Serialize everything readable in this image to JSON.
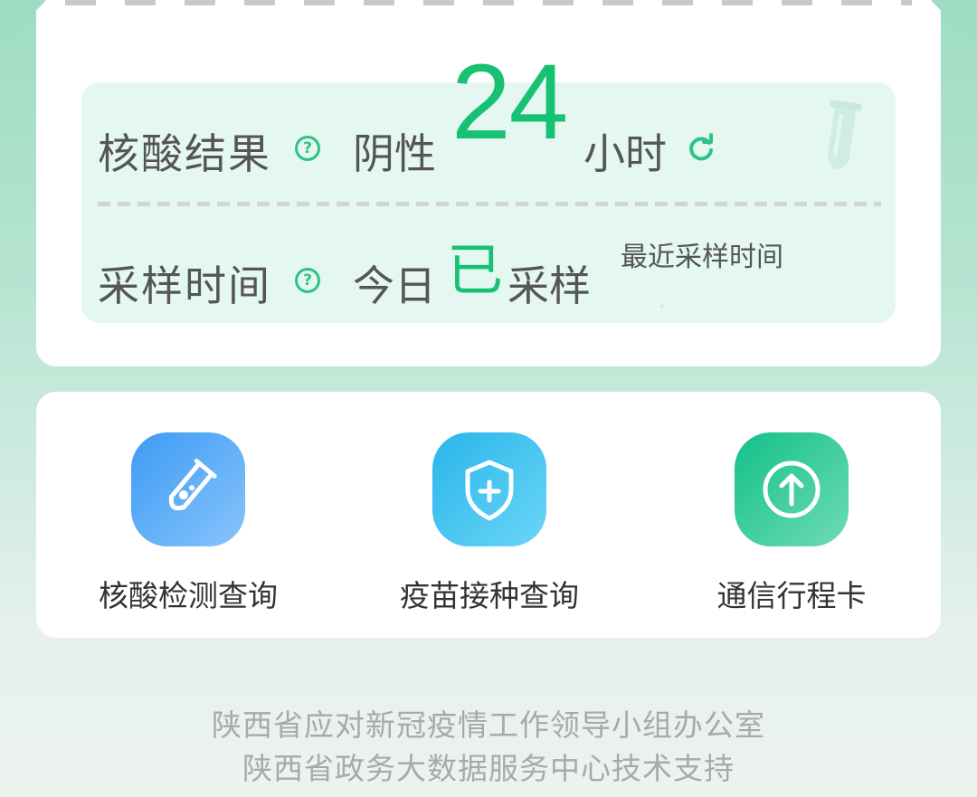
{
  "status": {
    "result_label": "核酸结果",
    "result_value": "阴性",
    "hours_number": "24",
    "hours_unit": "小时",
    "sampling_label": "采样时间",
    "sampling_prefix": "今日",
    "sampling_highlight": "已",
    "sampling_suffix": "采样",
    "recent_label": "最近采样时间"
  },
  "services": [
    {
      "label": "核酸检测查询",
      "icon": "test-tube-icon",
      "gradient": [
        "#3d9bf5",
        "#88c4fb"
      ]
    },
    {
      "label": "疫苗接种查询",
      "icon": "shield-plus-icon",
      "gradient": [
        "#2ab5ea",
        "#6ad6f7"
      ]
    },
    {
      "label": "通信行程卡",
      "icon": "arrow-up-circle-icon",
      "gradient": [
        "#14c08a",
        "#6edbb5"
      ]
    }
  ],
  "footer": {
    "line1": "陕西省应对新冠疫情工作领导小组办公室",
    "line2": "陕西省政务大数据服务中心技术支持"
  },
  "colors": {
    "accent_green": "#17c172",
    "help_icon_green": "#2ec385",
    "panel_bg": "#e4f7f0"
  }
}
